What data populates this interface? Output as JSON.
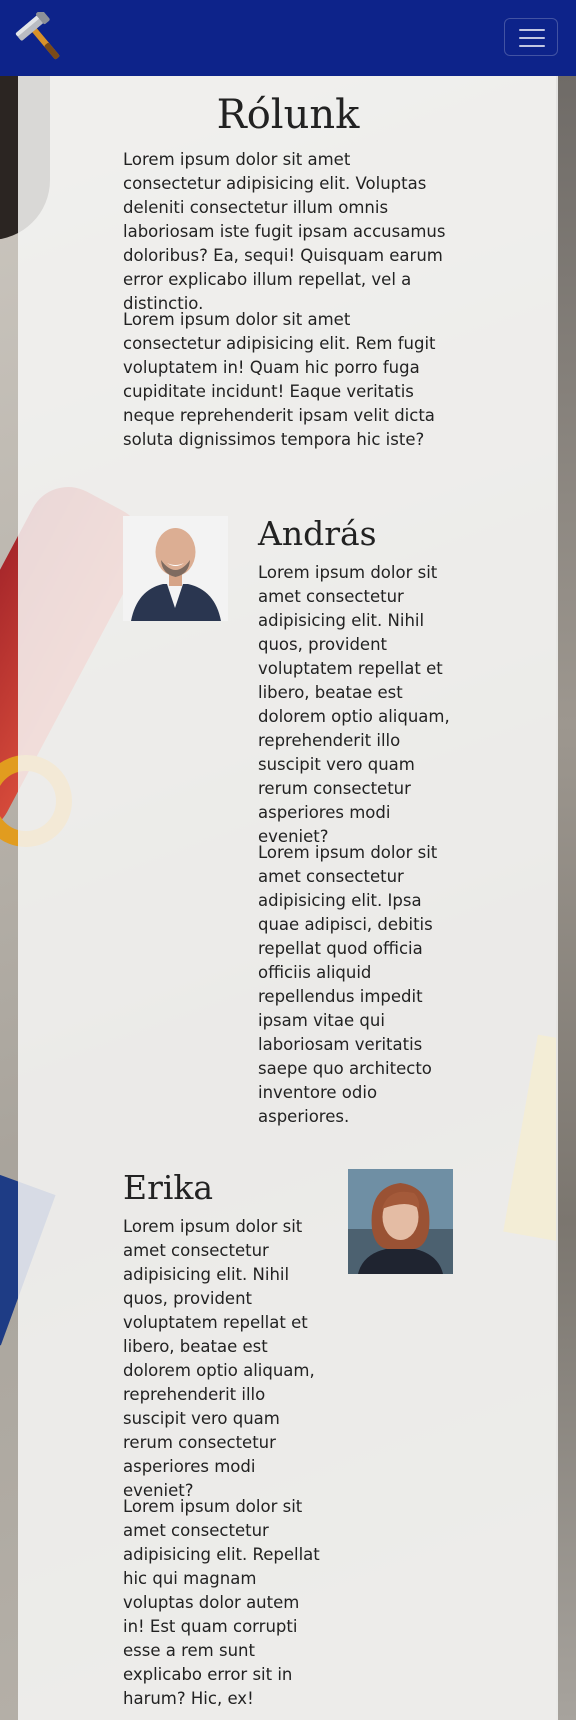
{
  "navbar": {
    "logo_icon": "hammer-icon",
    "toggle_icon": "hamburger-menu-icon",
    "background": "#0d238a"
  },
  "about": {
    "title": "Rólunk",
    "paragraphs": [
      "Lorem ipsum dolor sit amet consectetur adipisicing elit. Voluptas deleniti consectetur illum omnis laboriosam iste fugit ipsam accusamus doloribus? Ea, sequi! Quisquam earum error explicabo illum repellat, vel a distinctio.",
      "Lorem ipsum dolor sit amet consectetur adipisicing elit. Rem fugit voluptatem in! Quam hic porro fuga cupiditate incidunt! Eaque veritatis neque reprehenderit ipsam velit dicta soluta dignissimos tempora hic iste?"
    ]
  },
  "team": [
    {
      "name": "András",
      "photo_icon": "portrait-photo",
      "paragraphs": [
        "Lorem ipsum dolor sit amet consectetur adipisicing elit. Nihil quos, provident voluptatem repellat et libero, beatae est dolorem optio aliquam, reprehenderit illo suscipit vero quam rerum consectetur asperiores modi eveniet?",
        "Lorem ipsum dolor sit amet consectetur adipisicing elit. Ipsa quae adipisci, debitis repellat quod officia officiis aliquid repellendus impedit ipsam vitae qui laboriosam veritatis saepe quo architecto inventore odio asperiores."
      ]
    },
    {
      "name": "Erika",
      "photo_icon": "portrait-photo",
      "paragraphs": [
        "Lorem ipsum dolor sit amet consectetur adipisicing elit. Nihil quos, provident voluptatem repellat et libero, beatae est dolorem optio aliquam, reprehenderit illo suscipit vero quam rerum consectetur asperiores modi eveniet?",
        "Lorem ipsum dolor sit amet consectetur adipisicing elit. Repellat hic qui magnam voluptas dolor autem in! Est quam corrupti esse a rem sunt explicabo error sit in harum? Hic, ex!"
      ]
    }
  ]
}
